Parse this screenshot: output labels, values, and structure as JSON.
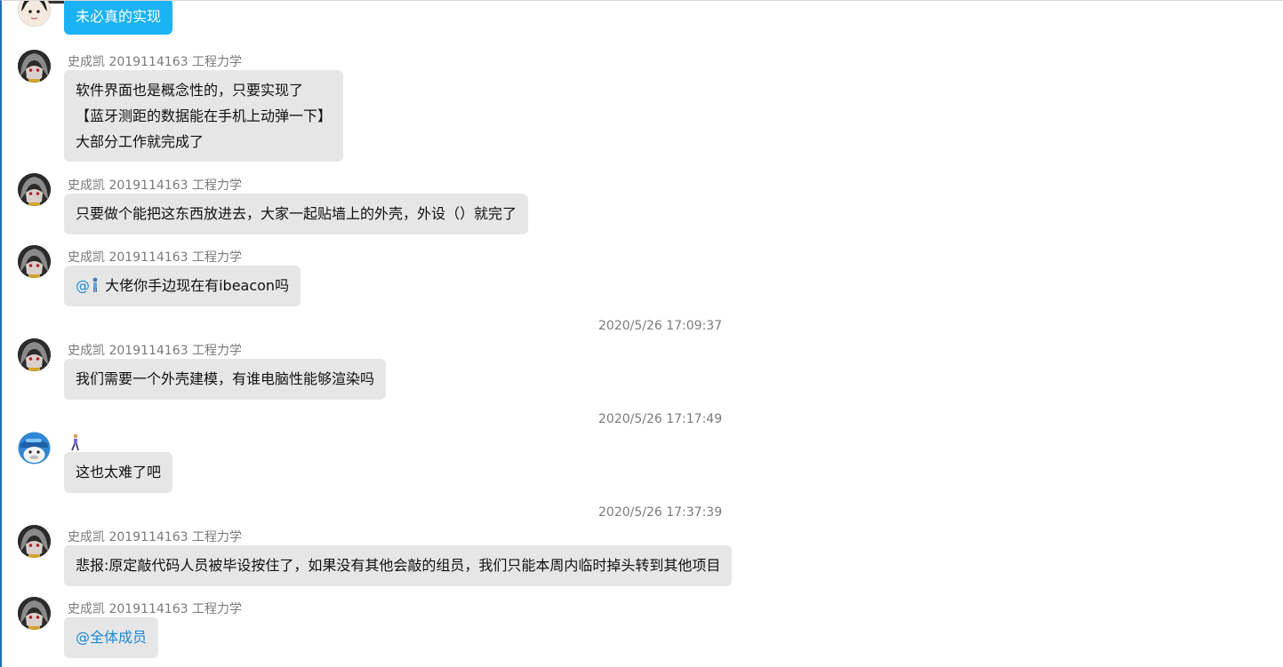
{
  "messages": [
    {
      "sender": "",
      "lines": [
        "未必真的实现"
      ],
      "style": "blue"
    },
    {
      "sender": "史成凯 2019114163 工程力学",
      "lines": [
        "软件界面也是概念性的，只要实现了",
        "【蓝牙测距的数据能在手机上动弹一下】",
        "大部分工作就完成了"
      ]
    },
    {
      "sender": "史成凯 2019114163 工程力学",
      "lines": [
        "只要做个能把这东西放进去，大家一起贴墙上的外壳，外设（）就完了"
      ]
    },
    {
      "sender": "史成凯 2019114163 工程力学",
      "mention": "@",
      "text_after_mention": "大佬你手边现在有ibeacon吗"
    },
    {
      "sender": "史成凯 2019114163 工程力学",
      "lines": [
        "我们需要一个外壳建模，有谁电脑性能够渲染吗"
      ]
    },
    {
      "sender_emoji": "🚶",
      "lines": [
        "这也太难了吧"
      ]
    },
    {
      "sender": "史成凯 2019114163 工程力学",
      "lines": [
        "悲报:原定敲代码人员被毕设按住了，如果没有其他会敲的组员，我们只能本周内临时掉头转到其他项目"
      ]
    },
    {
      "sender": "史成凯 2019114163 工程力学",
      "mention": "@全体成员"
    }
  ],
  "timestamps": [
    "2020/5/26 17:09:37",
    "2020/5/26 17:17:49",
    "2020/5/26 17:37:39"
  ],
  "colors": {
    "bubble_gray": "#e6e6e6",
    "bubble_blue": "#1ab2f2",
    "mention": "#1a8ad8",
    "meta_text": "#7a7a7a",
    "left_border": "#1e6fb8"
  },
  "icons": {
    "mention_person": "person-standing-icon",
    "sender_status": "walking-person-icon"
  }
}
